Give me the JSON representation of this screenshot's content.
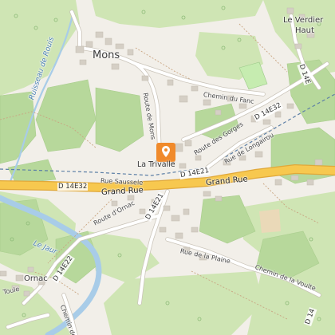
{
  "map": {
    "colors": {
      "background": "#f2efe9",
      "forest": "#c9e1ab",
      "vineyard": "#b5d69a",
      "road_primary": "#f7c84f",
      "road_casing": "#e0a83a",
      "water": "#a8cce8",
      "building": "#d5cfc5",
      "marker": "#f08a2b"
    },
    "labels": {
      "mons": "Mons",
      "le_verdier": "Le Verdier",
      "haut": "Haut",
      "ornac": "Ornac",
      "la_trivalle": "La Trivalle",
      "ruisseau_de_rouis": "Ruisseau de Rouis",
      "le_jaur": "Le Jaur",
      "route_de_mons": "Route de Mons",
      "chemin_du_fanc": "Chemin du Fanc",
      "route_des_gorges": "Route des Gorges",
      "rue_de_longairou": "Rue de Longairou",
      "rue_saussele": "Rue Saussele",
      "grand_rue_left": "Grand Rue",
      "grand_rue_right": "Grand Rue",
      "route_d_ornac": "Route d'Ornac",
      "rue_de_la_plaine": "Rue de la Plaine",
      "chemin_de_la_voulte": "Chemin de la Voulte",
      "toule": "Toule",
      "chemin_de": "Chemin de"
    },
    "road_refs": {
      "d14e32_main": "D 14E32",
      "d14e32_ne": "D 14E32",
      "d14e21": "D 14E21",
      "d14e21_south": "D 14E21",
      "d14e22": "D 14E22",
      "d14e_top": "D 14E",
      "d14_south": "D 14"
    },
    "marker": {
      "icon": "map-pin-icon"
    }
  }
}
